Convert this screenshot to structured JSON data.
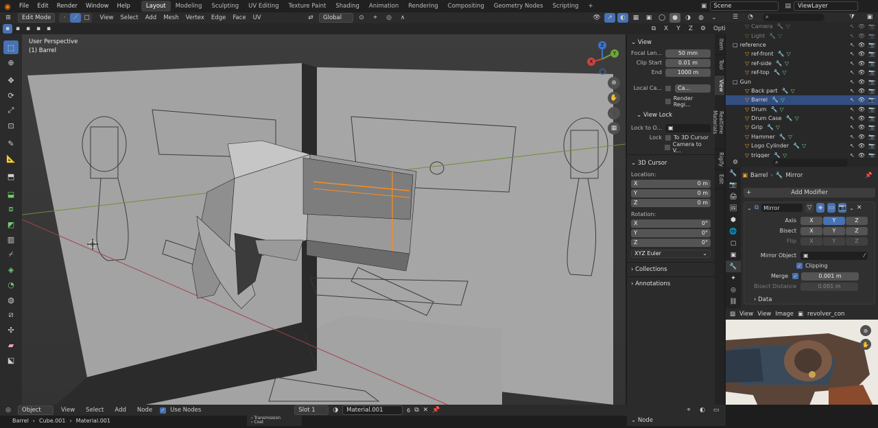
{
  "topbar": {
    "menus": [
      "File",
      "Edit",
      "Render",
      "Window",
      "Help"
    ],
    "workspaces": [
      "Layout",
      "Modeling",
      "Sculpting",
      "UV Editing",
      "Texture Paint",
      "Shading",
      "Animation",
      "Rendering",
      "Compositing",
      "Geometry Nodes",
      "Scripting"
    ],
    "active_workspace": "Layout",
    "scene": "Scene",
    "view_layer": "ViewLayer"
  },
  "viewport_header": {
    "mode": "Edit Mode",
    "menus": [
      "View",
      "Select",
      "Add",
      "Mesh",
      "Vertex",
      "Edge",
      "Face",
      "UV"
    ],
    "orientation": "Global",
    "axes": [
      "X",
      "Y",
      "Z"
    ],
    "options": "Options"
  },
  "viewport": {
    "perspective": "User Perspective",
    "object": "(1) Barrel",
    "gizmo": {
      "z": "Z",
      "y": "Y",
      "x": "X"
    }
  },
  "npanel": {
    "view_title": "View",
    "focal_label": "Focal Len...",
    "focal_value": "50 mm",
    "clip_start_label": "Clip Start",
    "clip_start_value": "0.01 m",
    "end_label": "End",
    "end_value": "1000 m",
    "local_camera_label": "Local Ca...",
    "local_camera_value": "Ca...",
    "render_region": "Render Regi...",
    "view_lock_title": "View Lock",
    "lock_to_label": "Lock to O...",
    "lock_label": "Lock",
    "to_cursor": "To 3D Cursor",
    "camera_to_view": "Camera to V...",
    "cursor_title": "3D Cursor",
    "location_label": "Location:",
    "loc": [
      {
        "axis": "X",
        "val": "0 m"
      },
      {
        "axis": "Y",
        "val": "0 m"
      },
      {
        "axis": "Z",
        "val": "0 m"
      }
    ],
    "rotation_label": "Rotation:",
    "rot": [
      {
        "axis": "X",
        "val": "0°"
      },
      {
        "axis": "Y",
        "val": "0°"
      },
      {
        "axis": "Z",
        "val": "0°"
      }
    ],
    "rot_mode": "XYZ Euler",
    "collections": "Collections",
    "annotations": "Annotations"
  },
  "sidebar_tabs": [
    "Item",
    "Tool",
    "View",
    "Realtime Materials",
    "Rigify",
    "Edit"
  ],
  "outliner": {
    "rows": [
      {
        "name": "Camera",
        "indent": 28,
        "dim": true
      },
      {
        "name": "Light",
        "indent": 28,
        "dim": true
      },
      {
        "name": "reference",
        "indent": 10
      },
      {
        "name": "ref-front",
        "indent": 28
      },
      {
        "name": "ref-side",
        "indent": 28
      },
      {
        "name": "ref-top",
        "indent": 28
      },
      {
        "name": "Gun",
        "indent": 10
      },
      {
        "name": "Back part",
        "indent": 28
      },
      {
        "name": "Barrel",
        "indent": 28,
        "sel": true
      },
      {
        "name": "Drum",
        "indent": 28
      },
      {
        "name": "Drum Case",
        "indent": 28
      },
      {
        "name": "Grip",
        "indent": 28
      },
      {
        "name": "Hammer",
        "indent": 28
      },
      {
        "name": "Logo Cylinder",
        "indent": 28
      },
      {
        "name": "trigger",
        "indent": 28
      }
    ]
  },
  "properties": {
    "breadcrumb_object": "Barrel",
    "breadcrumb_modifier": "Mirror",
    "add_modifier": "Add Modifier",
    "modifier_name": "Mirror",
    "axis_label": "Axis",
    "bisect_label": "Bisect",
    "flip_label": "Flip",
    "x": "X",
    "y": "Y",
    "z": "Z",
    "mirror_object_label": "Mirror Object",
    "clipping": "Clipping",
    "merge_label": "Merge",
    "merge_value": "0.001 m",
    "bisect_distance_label": "Bisect Distance",
    "bisect_distance_value": "0.001 m",
    "data": "Data"
  },
  "image_editor": {
    "menus": [
      "View",
      "View",
      "Image"
    ],
    "image_name": "revolver_con"
  },
  "bottom": {
    "mode": "Object",
    "menus": [
      "View",
      "Select",
      "Add",
      "Node"
    ],
    "use_nodes": "Use Nodes",
    "slot": "Slot 1",
    "material": "Material.001",
    "users": "6",
    "node_panel": "Node",
    "breadcrumb": [
      "Barrel",
      "Cube.001",
      "Material.001"
    ],
    "tree": [
      "Transmission",
      "Coat"
    ]
  },
  "colors": {
    "accent": "#4772b3",
    "selected_edge": "#ff8c1a",
    "outliner_sel": "#334d80"
  }
}
